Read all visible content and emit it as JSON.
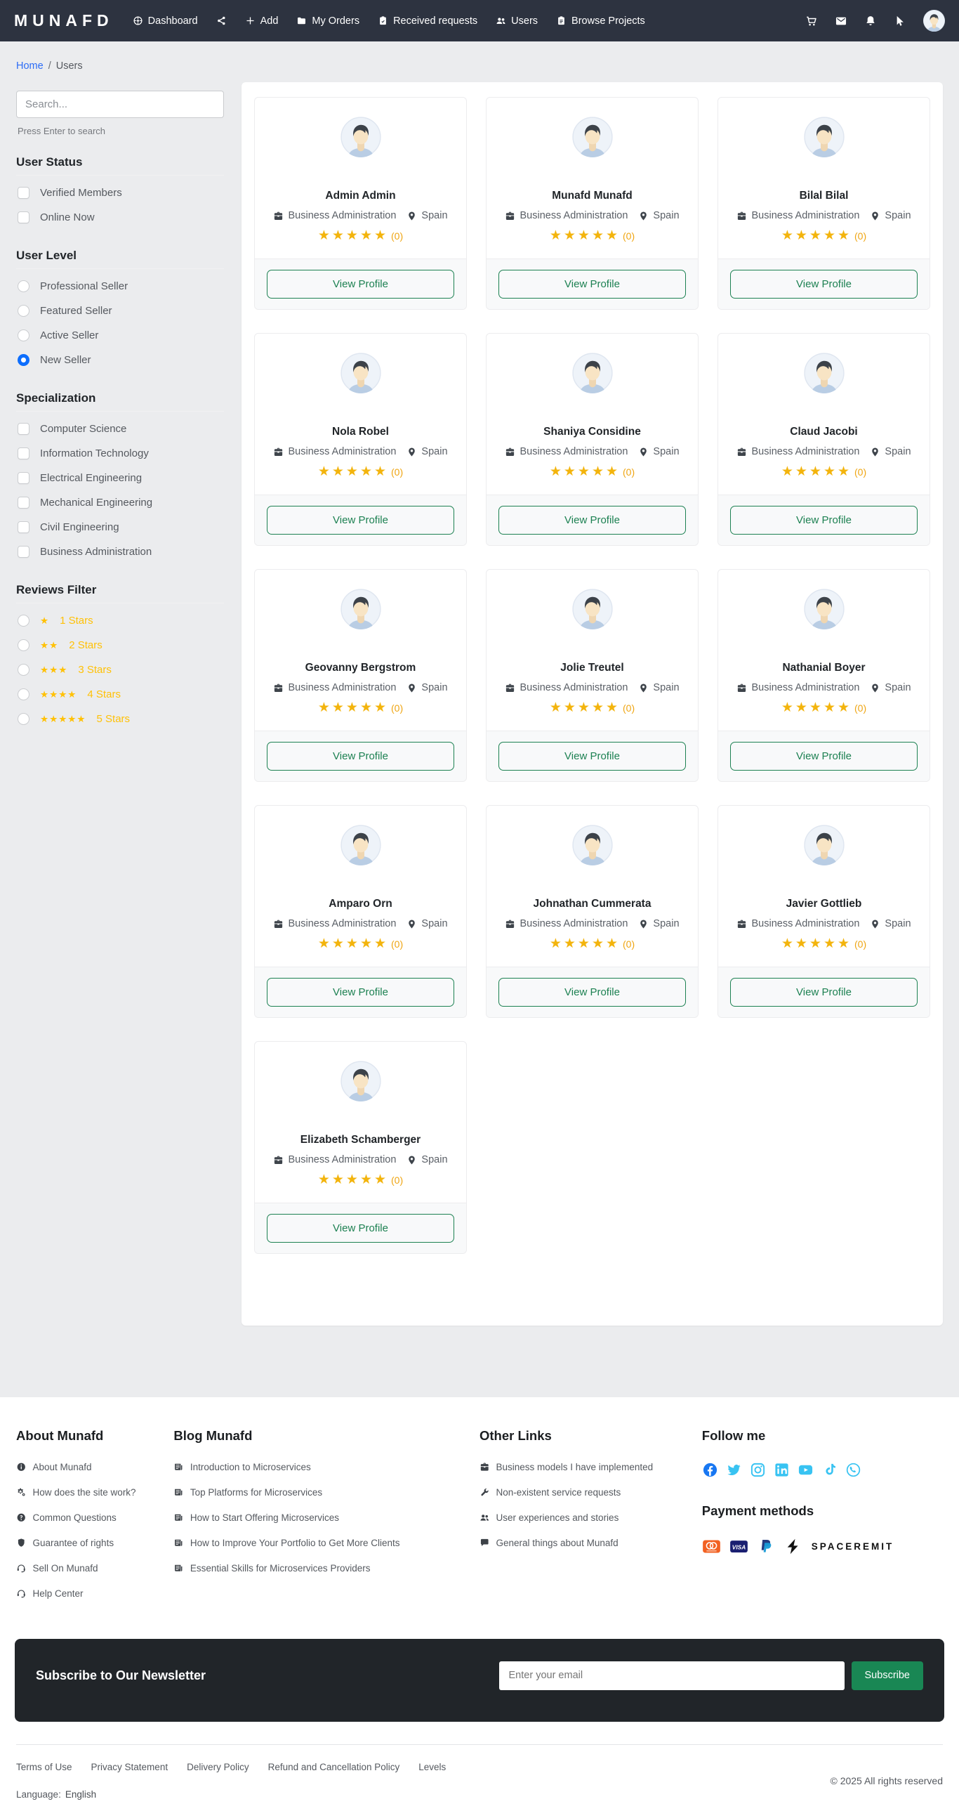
{
  "colors": {
    "navbar_bg": "#2d3340",
    "link_blue": "#2c6cf6",
    "radio_selected_blue": "#0d6efd",
    "star_gold": "#f3b40d",
    "filter_star_yellow": "#ffc107",
    "button_green": "#1d8152",
    "subscribe_green": "#198754",
    "newsletter_bg": "#212529",
    "facebook_blue": "#1877f2",
    "social_blue": "#38c3f2"
  },
  "navbar": {
    "brand": "MUNAFD",
    "links": [
      {
        "icon": "dashboard-icon",
        "label": "Dashboard"
      },
      {
        "icon": "share-nodes-icon",
        "label": ""
      },
      {
        "icon": "plus-icon",
        "label": "Add"
      },
      {
        "icon": "folder-icon",
        "label": "My Orders"
      },
      {
        "icon": "clipboard-icon",
        "label": "Received requests"
      },
      {
        "icon": "users-icon",
        "label": "Users"
      },
      {
        "icon": "clipboard-list-icon",
        "label": "Browse Projects"
      }
    ],
    "right_icons": [
      "cart-icon",
      "envelope-icon",
      "bell-icon",
      "pointer-icon"
    ]
  },
  "breadcrumb": {
    "home": "Home",
    "separator": "/",
    "current": "Users"
  },
  "sidebar": {
    "search": {
      "placeholder": "Search...",
      "hint": "Press Enter to search"
    },
    "sections": [
      {
        "title": "User Status",
        "control": "checkbox",
        "options": [
          {
            "label": "Verified Members",
            "checked": false
          },
          {
            "label": "Online Now",
            "checked": false
          }
        ]
      },
      {
        "title": "User Level",
        "control": "radio",
        "options": [
          {
            "label": "Professional Seller",
            "checked": false
          },
          {
            "label": "Featured Seller",
            "checked": false
          },
          {
            "label": "Active Seller",
            "checked": false
          },
          {
            "label": "New Seller",
            "checked": true
          }
        ]
      },
      {
        "title": "Specialization",
        "control": "checkbox",
        "options": [
          {
            "label": "Computer Science",
            "checked": false
          },
          {
            "label": "Information Technology",
            "checked": false
          },
          {
            "label": "Electrical Engineering",
            "checked": false
          },
          {
            "label": "Mechanical Engineering",
            "checked": false
          },
          {
            "label": "Civil Engineering",
            "checked": false
          },
          {
            "label": "Business Administration",
            "checked": false
          }
        ]
      },
      {
        "title": "Reviews Filter",
        "control": "radio",
        "options": [
          {
            "label": "1 Stars",
            "stars": 1,
            "checked": false
          },
          {
            "label": "2 Stars",
            "stars": 2,
            "checked": false
          },
          {
            "label": "3 Stars",
            "stars": 3,
            "checked": false
          },
          {
            "label": "4 Stars",
            "stars": 4,
            "checked": false
          },
          {
            "label": "5 Stars",
            "stars": 5,
            "checked": false
          }
        ]
      }
    ]
  },
  "users": {
    "defaults": {
      "specialization": "Business Administration",
      "country": "Spain",
      "stars": 5,
      "rating_count": "(0)",
      "button_label": "View Profile"
    },
    "list": [
      {
        "name": "Admin Admin"
      },
      {
        "name": "Munafd Munafd"
      },
      {
        "name": "Bilal Bilal"
      },
      {
        "name": "Nola Robel"
      },
      {
        "name": "Shaniya Considine"
      },
      {
        "name": "Claud Jacobi"
      },
      {
        "name": "Geovanny Bergstrom"
      },
      {
        "name": "Jolie Treutel"
      },
      {
        "name": "Nathanial Boyer"
      },
      {
        "name": "Amparo Orn"
      },
      {
        "name": "Johnathan Cummerata"
      },
      {
        "name": "Javier Gottlieb"
      },
      {
        "name": "Elizabeth Schamberger"
      }
    ]
  },
  "footer": {
    "columns": [
      {
        "title": "About Munafd",
        "links": [
          {
            "icon": "info-circle-icon",
            "label": "About Munafd"
          },
          {
            "icon": "gears-icon",
            "label": "How does the site work?"
          },
          {
            "icon": "question-circle-icon",
            "label": "Common Questions"
          },
          {
            "icon": "shield-icon",
            "label": "Guarantee of rights"
          },
          {
            "icon": "headset-icon",
            "label": "Sell On Munafd"
          },
          {
            "icon": "headset-icon",
            "label": "Help Center"
          }
        ]
      },
      {
        "title": "Blog Munafd",
        "links": [
          {
            "icon": "newspaper-icon",
            "label": "Introduction to Microservices"
          },
          {
            "icon": "newspaper-icon",
            "label": "Top Platforms for Microservices"
          },
          {
            "icon": "newspaper-icon",
            "label": "How to Start Offering Microservices"
          },
          {
            "icon": "newspaper-icon",
            "label": "How to Improve Your Portfolio to Get More Clients"
          },
          {
            "icon": "newspaper-icon",
            "label": "Essential Skills for Microservices Providers"
          }
        ]
      },
      {
        "title": "Other Links",
        "links": [
          {
            "icon": "briefcase-icon",
            "label": "Business models I have implemented"
          },
          {
            "icon": "wrench-icon",
            "label": "Non-existent service requests"
          },
          {
            "icon": "users-icon",
            "label": "User experiences and stories"
          },
          {
            "icon": "comment-icon",
            "label": "General things about Munafd"
          }
        ]
      }
    ],
    "follow": {
      "title": "Follow me",
      "icons": [
        "facebook-icon",
        "twitter-icon",
        "instagram-icon",
        "linkedin-icon",
        "youtube-icon",
        "tiktok-icon",
        "whatsapp-icon"
      ]
    },
    "payment": {
      "title": "Payment methods",
      "methods": [
        "mastercard-icon",
        "visa-icon",
        "paypal-icon",
        "spaceremit-icon"
      ],
      "spaceremit_label": "SPACEREMIT"
    }
  },
  "newsletter": {
    "title": "Subscribe to Our Newsletter",
    "placeholder": "Enter your email",
    "button": "Subscribe"
  },
  "legal": {
    "links": [
      "Terms of Use",
      "Privacy Statement",
      "Delivery Policy",
      "Refund and Cancellation Policy",
      "Levels"
    ],
    "copyright": "© 2025 All rights reserved",
    "language_label": "Language:",
    "language_value": "English"
  }
}
